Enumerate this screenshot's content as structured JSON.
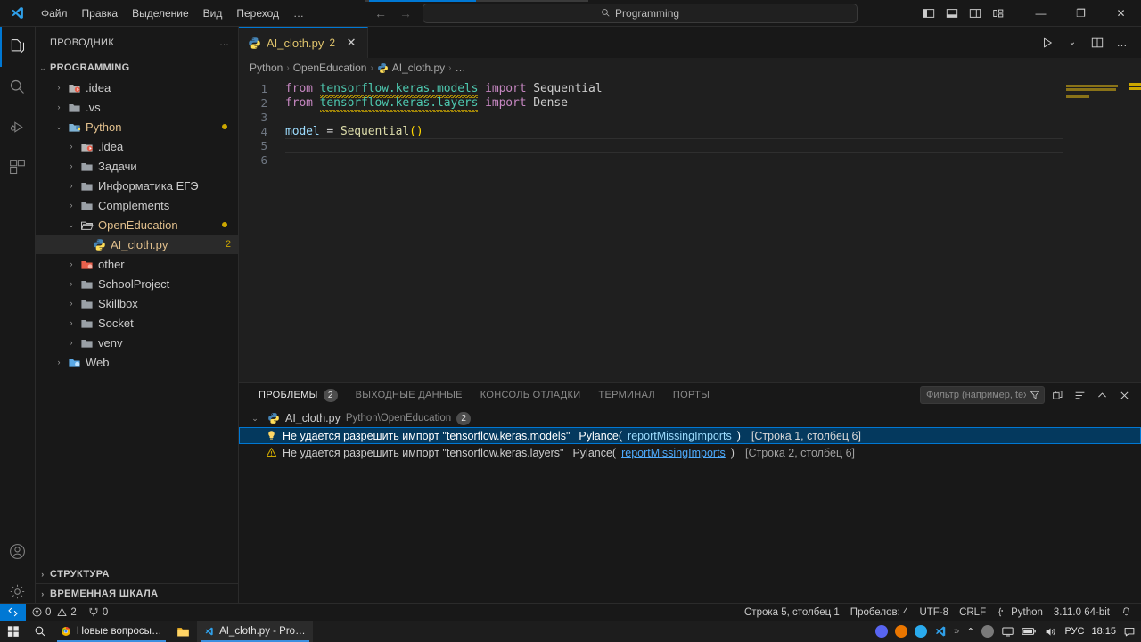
{
  "titlebar": {
    "menus": [
      "Файл",
      "Правка",
      "Выделение",
      "Вид",
      "Переход",
      "…"
    ],
    "command_center": "Programming",
    "search_icon": "search-icon",
    "back_arrow": "←",
    "forward_arrow": "→",
    "minimize": "―",
    "maximize": "❐",
    "close": "✕"
  },
  "activitybar": {
    "items": [
      {
        "name": "explorer",
        "icon": "files-icon"
      },
      {
        "name": "search",
        "icon": "search-icon"
      },
      {
        "name": "run-debug",
        "icon": "run-debug-icon"
      },
      {
        "name": "extensions",
        "icon": "extensions-icon"
      }
    ],
    "bottom": [
      {
        "name": "accounts",
        "icon": "account-icon"
      },
      {
        "name": "manage",
        "icon": "gear-icon"
      }
    ]
  },
  "sidebar": {
    "title": "ПРОВОДНИК",
    "more_actions": "…",
    "root": "PROGRAMMING",
    "tree": [
      {
        "label": ".idea",
        "indent": 1,
        "type": "folder",
        "arrow": "›",
        "icon": "folder-idea",
        "dot": false
      },
      {
        "label": ".vs",
        "indent": 1,
        "type": "folder",
        "arrow": "›",
        "icon": "folder",
        "dot": false
      },
      {
        "label": "Python",
        "indent": 1,
        "type": "folder",
        "arrow": "⌄",
        "icon": "folder-python-open",
        "dot": true,
        "modified": true
      },
      {
        "label": ".idea",
        "indent": 2,
        "type": "folder",
        "arrow": "›",
        "icon": "folder-idea",
        "dot": false
      },
      {
        "label": "Задачи",
        "indent": 2,
        "type": "folder",
        "arrow": "›",
        "icon": "folder",
        "dot": false
      },
      {
        "label": "Информатика ЕГЭ",
        "indent": 2,
        "type": "folder",
        "arrow": "›",
        "icon": "folder",
        "dot": false
      },
      {
        "label": "Complements",
        "indent": 2,
        "type": "folder",
        "arrow": "›",
        "icon": "folder",
        "dot": false
      },
      {
        "label": "OpenEducation",
        "indent": 2,
        "type": "folder",
        "arrow": "⌄",
        "icon": "folder-open",
        "dot": true,
        "modified": true
      },
      {
        "label": "AI_cloth.py",
        "indent": 3,
        "type": "file",
        "arrow": "",
        "icon": "python-icon",
        "count": "2",
        "selected": true
      },
      {
        "label": "other",
        "indent": 2,
        "type": "folder",
        "arrow": "›",
        "icon": "folder-red",
        "dot": false
      },
      {
        "label": "SchoolProject",
        "indent": 2,
        "type": "folder",
        "arrow": "›",
        "icon": "folder",
        "dot": false
      },
      {
        "label": "Skillbox",
        "indent": 2,
        "type": "folder",
        "arrow": "›",
        "icon": "folder",
        "dot": false
      },
      {
        "label": "Socket",
        "indent": 2,
        "type": "folder",
        "arrow": "›",
        "icon": "folder",
        "dot": false
      },
      {
        "label": "venv",
        "indent": 2,
        "type": "folder",
        "arrow": "›",
        "icon": "folder",
        "dot": false
      },
      {
        "label": "Web",
        "indent": 1,
        "type": "folder",
        "arrow": "›",
        "icon": "folder-web",
        "dot": false
      }
    ],
    "sections": [
      {
        "label": "СТРУКТУРА",
        "arrow": "›"
      },
      {
        "label": "ВРЕМЕННАЯ ШКАЛА",
        "arrow": "›"
      }
    ]
  },
  "editor": {
    "tab": {
      "filename": "AI_cloth.py",
      "count": "2",
      "close": "✕",
      "icon": "python-icon"
    },
    "actions": {
      "run": "run-icon",
      "run_chevron": "⌄",
      "split": "split-editor-icon",
      "more": "…"
    },
    "breadcrumb": [
      {
        "label": "Python",
        "icon": ""
      },
      {
        "label": "OpenEducation",
        "icon": ""
      },
      {
        "label": "AI_cloth.py",
        "icon": "python-icon"
      },
      {
        "label": "…",
        "icon": ""
      }
    ],
    "breadcrumb_sep": "›",
    "lines": [
      {
        "n": "1",
        "tokens": [
          {
            "t": "from",
            "c": "kw"
          },
          {
            "t": " ",
            "c": "plain"
          },
          {
            "t": "tensorflow.keras.models",
            "c": "mod",
            "squiggle": true
          },
          {
            "t": " ",
            "c": "plain"
          },
          {
            "t": "import",
            "c": "kw"
          },
          {
            "t": " ",
            "c": "plain"
          },
          {
            "t": "Sequential",
            "c": "plain"
          }
        ]
      },
      {
        "n": "2",
        "tokens": [
          {
            "t": "from",
            "c": "kw"
          },
          {
            "t": " ",
            "c": "plain"
          },
          {
            "t": "tensorflow.keras.layers",
            "c": "mod",
            "squiggle": true
          },
          {
            "t": " ",
            "c": "plain"
          },
          {
            "t": "import",
            "c": "kw"
          },
          {
            "t": " ",
            "c": "plain"
          },
          {
            "t": "Dense",
            "c": "plain"
          }
        ]
      },
      {
        "n": "3",
        "tokens": []
      },
      {
        "n": "4",
        "tokens": [
          {
            "t": "model",
            "c": "ident"
          },
          {
            "t": " ",
            "c": "plain"
          },
          {
            "t": "=",
            "c": "op"
          },
          {
            "t": " ",
            "c": "plain"
          },
          {
            "t": "Sequential",
            "c": "fn"
          },
          {
            "t": "()",
            "c": "paren"
          }
        ]
      },
      {
        "n": "5",
        "tokens": []
      },
      {
        "n": "6",
        "tokens": []
      }
    ]
  },
  "panel": {
    "tabs": [
      {
        "label": "ПРОБЛЕМЫ",
        "badge": "2",
        "active": true
      },
      {
        "label": "ВЫХОДНЫЕ ДАННЫЕ",
        "badge": "",
        "active": false
      },
      {
        "label": "КОНСОЛЬ ОТЛАДКИ",
        "badge": "",
        "active": false
      },
      {
        "label": "ТЕРМИНАЛ",
        "badge": "",
        "active": false
      },
      {
        "label": "ПОРТЫ",
        "badge": "",
        "active": false
      }
    ],
    "filter_placeholder": "Фильтр (например, text…",
    "filter_icon": "filter-icon",
    "actions": [
      {
        "name": "collapse-all-icon",
        "glyph": "⧉"
      },
      {
        "name": "view-as-table-icon",
        "glyph": "≡"
      },
      {
        "name": "maximize-panel-icon",
        "glyph": "⌃"
      },
      {
        "name": "close-panel-icon",
        "glyph": "✕"
      }
    ],
    "file_group": {
      "arrow": "⌄",
      "icon": "python-icon",
      "filename": "AI_cloth.py",
      "path": "Python\\OpenEducation",
      "badge": "2"
    },
    "problems": [
      {
        "severity": "hint",
        "icon": "lightbulb-icon",
        "message": "Не удается разрешить импорт \"tensorflow.keras.models\"",
        "source": "Pylance(",
        "code": "reportMissingImports",
        "source_close": ")",
        "location": "[Строка 1, столбец 6]",
        "selected": true
      },
      {
        "severity": "warning",
        "icon": "warning-icon",
        "message": "Не удается разрешить импорт \"tensorflow.keras.layers\"",
        "source": "Pylance(",
        "code": "reportMissingImports",
        "source_close": ")",
        "location": "[Строка 2, столбец 6]",
        "selected": false
      }
    ]
  },
  "statusbar": {
    "remote_icon": "remote-window-icon",
    "errors": "0",
    "warnings": "2",
    "ports": "0",
    "error_icon": "error-circle-icon",
    "warning_icon": "warning-triangle-icon",
    "ports_icon": "ports-icon",
    "line_col": "Строка 5, столбец 1",
    "spaces": "Пробелов: 4",
    "encoding": "UTF-8",
    "eol": "CRLF",
    "language": "Python",
    "language_icon": "python-brace-icon",
    "interpreter": "3.11.0 64-bit",
    "bell_icon": "bell-icon"
  },
  "taskbar": {
    "start_icon": "windows-start-icon",
    "search_icon": "search-icon",
    "apps": [
      {
        "label": "Новые вопросы — …",
        "icon": "chrome-icon",
        "active": false
      },
      {
        "label": "",
        "icon": "file-explorer-icon",
        "active": false
      },
      {
        "label": "AI_cloth.py - Program…",
        "icon": "vscode-icon",
        "active": true
      }
    ],
    "tray_icons": [
      "discord-icon",
      "blender-icon",
      "telegram-icon",
      "vscode-icon"
    ],
    "overflow": "»",
    "chevron": "⌃",
    "hidden_icons": [
      "onedrive-icon",
      "monitor-icon",
      "battery-icon",
      "volume-icon"
    ],
    "language": "РУС",
    "time": "18:15",
    "notification_icon": "notification-icon"
  }
}
